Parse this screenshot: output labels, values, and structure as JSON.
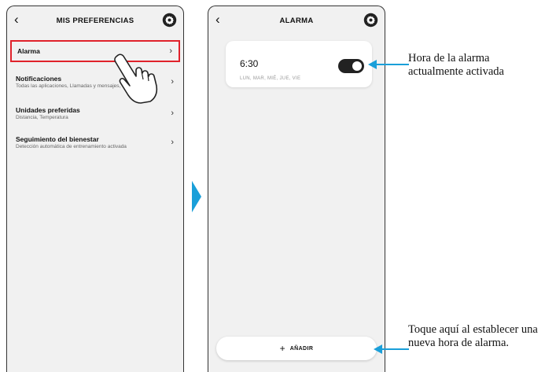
{
  "screen1": {
    "title": "MIS PREFERENCIAS",
    "back_icon": "chevron-left-icon",
    "settings_icon": "gear-icon",
    "items": [
      {
        "label": "Alarma",
        "subtitle": ""
      },
      {
        "label": "Notificaciones",
        "subtitle": "Todas las aplicaciones, Llamadas y mensajes, todos"
      },
      {
        "label": "Unidades preferidas",
        "subtitle": "Distancia, Temperatura"
      },
      {
        "label": "Seguimiento del bienestar",
        "subtitle": "Detección automática de entrenamiento activada"
      }
    ],
    "chevron": "›"
  },
  "screen2": {
    "title": "ALARMA",
    "alarm": {
      "time": "6:30",
      "days": "LUN, MAR, MIÉ, JUE, VIE",
      "enabled": true
    },
    "add_button": {
      "plus": "+",
      "label": "AÑADIR"
    }
  },
  "callouts": {
    "alarm_time": "Hora de la alarma actualmente activada",
    "add_new": "Toque aquí al establecer una nueva hora de alarma."
  },
  "colors": {
    "highlight": "#e0222b",
    "callout_accent": "#1a9fd9",
    "toggle_on": "#222222"
  }
}
